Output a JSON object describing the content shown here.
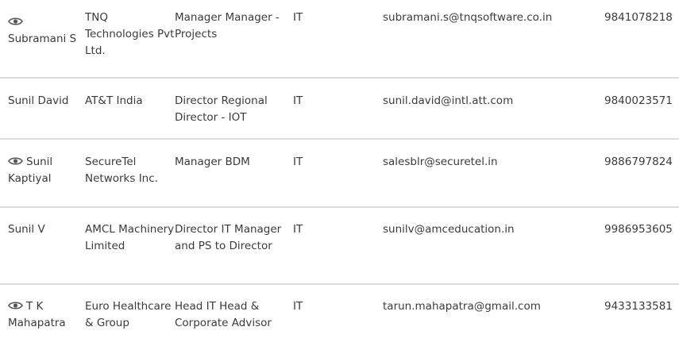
{
  "rows": [
    {
      "has_view_icon": true,
      "name": "Subramani S",
      "company": "TNQ Technologies Pvt Ltd.",
      "designation": "Manager Manager - Projects",
      "department": "IT",
      "email": "subramani.s@tnqsoftware.co.in",
      "phone": "9841078218"
    },
    {
      "has_view_icon": false,
      "name": "Sunil David",
      "company": "AT&T India",
      "designation": "Director Regional Director - IOT",
      "department": "IT",
      "email": "sunil.david@intl.att.com",
      "phone": "9840023571"
    },
    {
      "has_view_icon": true,
      "name": "Sunil Kaptiyal",
      "company": "SecureTel Networks Inc.",
      "designation": "Manager BDM",
      "department": "IT",
      "email": "salesblr@securetel.in",
      "phone": "9886797824"
    },
    {
      "has_view_icon": false,
      "name": "Sunil V",
      "company": "AMCL Machinery Limited",
      "designation": "Director IT Manager and PS to Director",
      "department": "IT",
      "email": "sunilv@amceducation.in",
      "phone": "9986953605"
    },
    {
      "has_view_icon": true,
      "name": "T K Mahapatra",
      "company": "Euro Healthcare & Group",
      "designation": "Head IT Head & Corporate Advisor",
      "department": "IT",
      "email": "tarun.mahapatra@gmail.com",
      "phone": "9433133581"
    }
  ],
  "icons": {
    "view": "eye-icon"
  },
  "colors": {
    "text": "#3a3a3a",
    "row_divider": "#dcdcdc",
    "icon": "#555555"
  }
}
